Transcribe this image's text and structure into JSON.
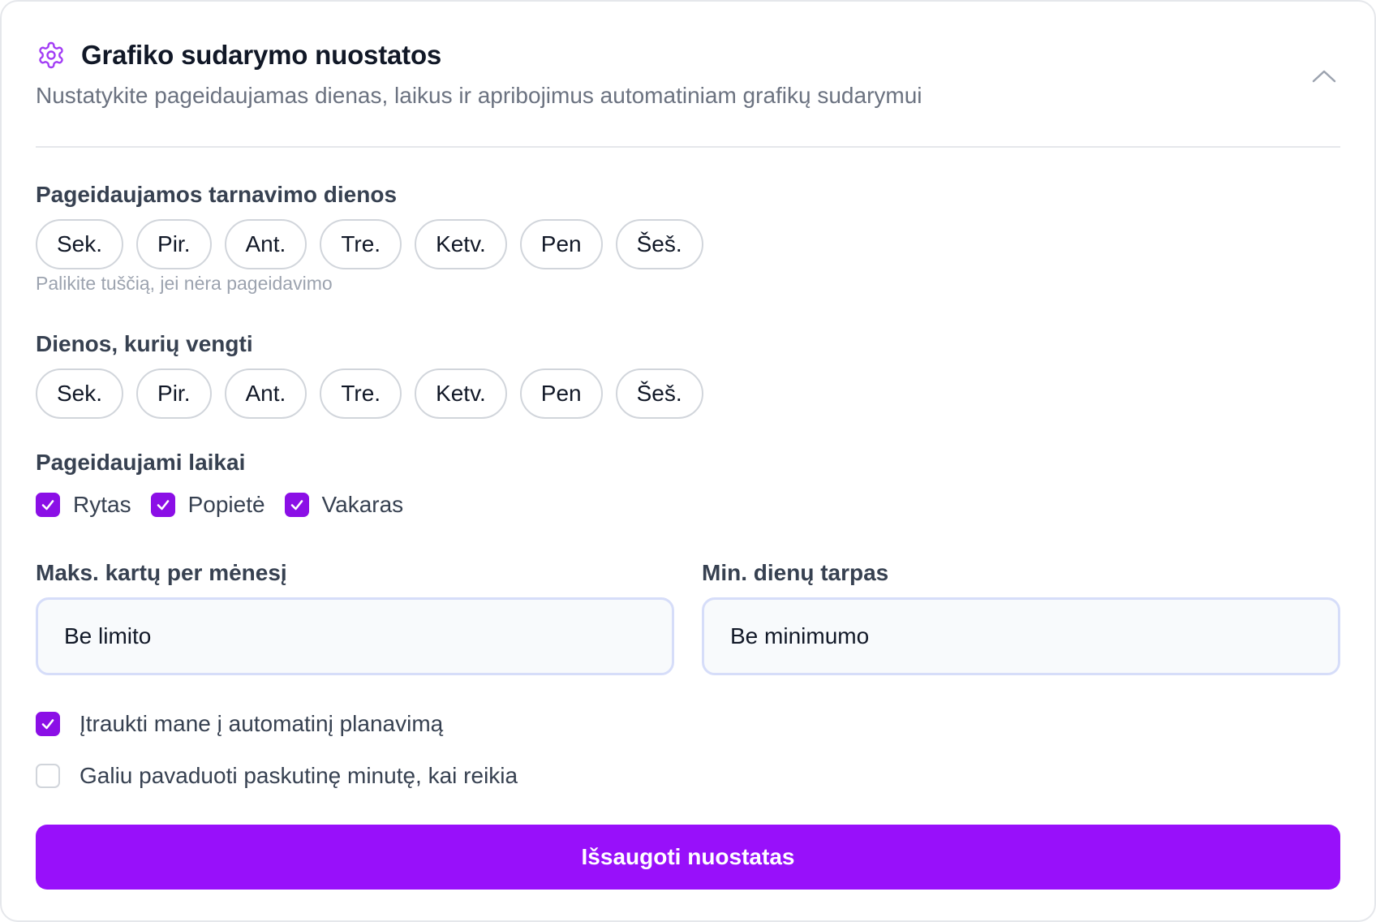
{
  "header": {
    "title": "Grafiko sudarymo nuostatos",
    "subtitle": "Nustatykite pageidaujamas dienas, laikus ir apribojimus automatiniam grafikų sudarymui"
  },
  "preferred_days": {
    "label": "Pageidaujamos tarnavimo dienos",
    "days": [
      "Sek.",
      "Pir.",
      "Ant.",
      "Tre.",
      "Ketv.",
      "Pen",
      "Šeš."
    ],
    "hint": "Palikite tuščią, jei nėra pageidavimo"
  },
  "avoid_days": {
    "label": "Dienos, kurių vengti",
    "days": [
      "Sek.",
      "Pir.",
      "Ant.",
      "Tre.",
      "Ketv.",
      "Pen",
      "Šeš."
    ]
  },
  "preferred_times": {
    "label": "Pageidaujami laikai",
    "options": [
      {
        "label": "Rytas",
        "checked": true
      },
      {
        "label": "Popietė",
        "checked": true
      },
      {
        "label": "Vakaras",
        "checked": true
      }
    ]
  },
  "max_per_month": {
    "label": "Maks. kartų per mėnesį",
    "value": "Be limito"
  },
  "min_gap": {
    "label": "Min. dienų tarpas",
    "value": "Be minimumo"
  },
  "options": [
    {
      "label": "Įtraukti mane į automatinį planavimą",
      "checked": true
    },
    {
      "label": "Galiu pavaduoti paskutinę minutę, kai reikia",
      "checked": false
    }
  ],
  "save_label": "Išsaugoti nuostatas",
  "colors": {
    "accent": "#9810fa",
    "checkbox": "#8b0fe6",
    "border": "#e5e7eb"
  }
}
